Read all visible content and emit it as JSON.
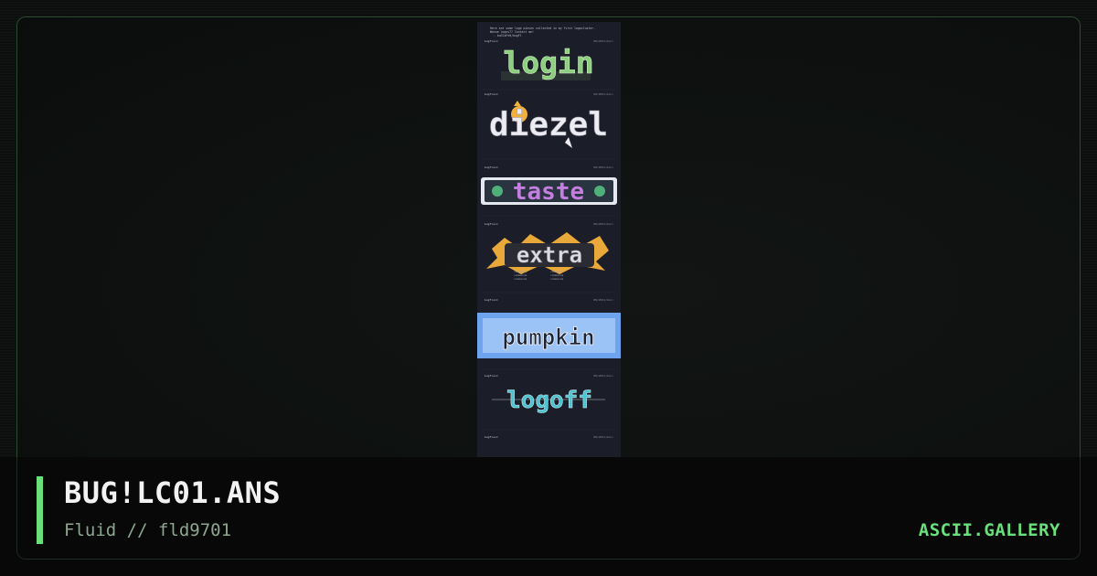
{
  "card": {
    "title": "BUG!LC01.ANS",
    "subtitle": "Fluid // fld9701",
    "brand": "ASCII.GALLERY"
  },
  "preview": {
    "intro_lines": [
      "Here are some logo pieces collected in my first logocluster.",
      "Wanna logos?? Contact me!",
      "- buGlaFe0/bugFl"
    ],
    "logos": [
      {
        "text": "login",
        "color": "#8ccf7e",
        "header_left": "bugfluid",
        "header_right": "08/2021/mini"
      },
      {
        "text": "diezel",
        "color": "#e9e9ee",
        "header_left": "bugfluid",
        "header_right": "08/2021/mini"
      },
      {
        "text": "taste",
        "color": "#c47ee0",
        "header_left": "bugfluid",
        "header_right": "08/2021/mini"
      },
      {
        "text": "extra",
        "color": "#d8d8dc",
        "header_left": "bugfluid",
        "header_right": "08/2021/mini"
      },
      {
        "text": "pumpkin",
        "color": "#7fb2f0",
        "header_left": "bugfluid",
        "header_right": "08/2021/mini"
      },
      {
        "text": "logoff",
        "color": "#4fc3cf",
        "header_left": "bugfluid",
        "header_right": "08/2021/mini"
      }
    ],
    "extra_menu": [
      "commands",
      "commands",
      "commands",
      "commands",
      "commands",
      "commands"
    ],
    "last_header_left": "bugfluid",
    "last_header_right": "08/2021/mini"
  },
  "colors": {
    "accent": "#69e07a",
    "frame_border": "#2c4a2e",
    "preview_bg": "#1b1d28"
  }
}
